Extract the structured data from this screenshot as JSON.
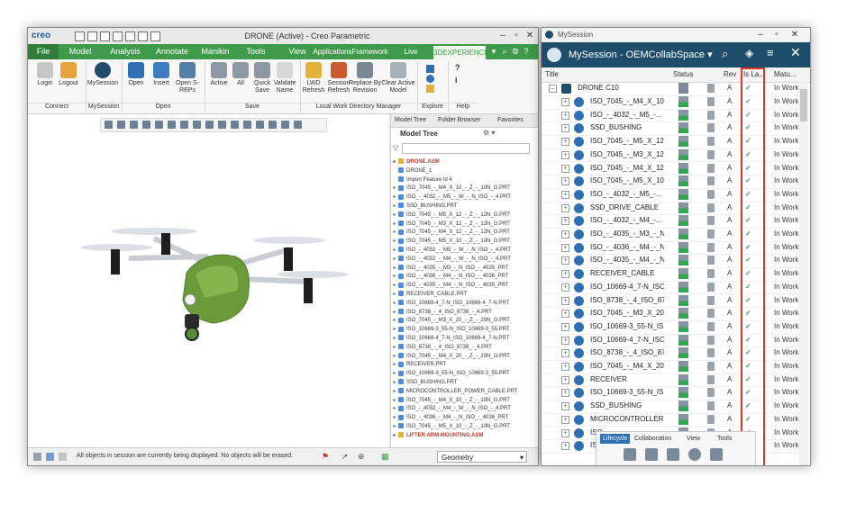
{
  "creo": {
    "logo": "creo",
    "window_title": "DRONE (Active) - Creo Parametric",
    "tabs": [
      "File",
      "Model",
      "Analysis",
      "Annotate",
      "Manikin",
      "Tools",
      "View",
      "ApplicationsFramework",
      "Live Simulation",
      "3DEXPERIENCE"
    ],
    "ribbon": {
      "buttons": [
        {
          "label": "Login"
        },
        {
          "label": "Logout"
        },
        {
          "label": "MySession"
        },
        {
          "label": "Open"
        },
        {
          "label": "Insert"
        },
        {
          "label": "Open S-REPs"
        },
        {
          "label": "Active"
        },
        {
          "label": "All"
        },
        {
          "label": "Quick Save"
        },
        {
          "label": "Validate Name"
        },
        {
          "label": "LWD Refresh"
        },
        {
          "label": "Session Refresh"
        },
        {
          "label": "Replace By Revision"
        },
        {
          "label": "Clear Active Model"
        }
      ],
      "groups": [
        "Connect",
        "MySession",
        "Open",
        "Save",
        "Local Work Directory Manager",
        "Explore",
        "Help"
      ]
    },
    "tree_tabs": [
      "Model Tree",
      "Folder Browser",
      "Favorites"
    ],
    "tree_header": "Model Tree",
    "tree_items": [
      {
        "t": "DRONE.ASM",
        "red": true
      },
      {
        "t": "DRONE_1"
      },
      {
        "t": "Import Feature id 4"
      },
      {
        "t": "ISO_7045_-_M4_X_10_-_Z_-_10N_G.PRT"
      },
      {
        "t": "ISO_-_4032_-_M5_-_W_-_N_ISO_-_4.PRT"
      },
      {
        "t": "SSD_BUSHING.PRT"
      },
      {
        "t": "ISO_7045_-_M5_X_12_-_Z_-_12N_G.PRT"
      },
      {
        "t": "ISO_7045_-_M3_X_12_-_Z_-_12N_G.PRT"
      },
      {
        "t": "ISO_7045_-_M4_X_12_-_Z_-_12N_G.PRT"
      },
      {
        "t": "ISO_7045_-_M5_X_10_-_Z_-_10N_G.PRT"
      },
      {
        "t": "ISO_-_4032_-_M5_-_W_-_N_ISO_-_4.PRT"
      },
      {
        "t": "ISO_-_4032_-_M4_-_W_-_N_ISO_-_4.PRT"
      },
      {
        "t": "ISO_-_4035_-_M3_-_N_ISO_-_4035_PRT"
      },
      {
        "t": "ISO_-_4036_-_M4_-_N_ISO_-_4036_PRT"
      },
      {
        "t": "ISO_-_4035_-_M4_-_N_ISO_-_4035_PRT"
      },
      {
        "t": "RECEIVER_CABLE.PRT"
      },
      {
        "t": "ISO_10669-4_7-N_ISO_10669-4_7-N.PRT"
      },
      {
        "t": "ISO_8738_-_4_ISO_8738_-_4.PRT"
      },
      {
        "t": "ISO_7045_-_M3_X_20_-_Z_-_20N_G.PRT"
      },
      {
        "t": "ISO_10669-3_55-N_ISO_10669-3_55.PRT"
      },
      {
        "t": "ISO_10669-4_7-N_ISO_10669-4_7-N.PRT"
      },
      {
        "t": "ISO_8738_-_4_ISO_8738_-_4.PRT"
      },
      {
        "t": "ISO_7045_-_M4_X_20_-_Z_-_20N_G.PRT"
      },
      {
        "t": "RECEIVER.PRT"
      },
      {
        "t": "ISO_10669-3_55-N_ISO_10669-3_55.PRT"
      },
      {
        "t": "SSD_BUSHING.PRT"
      },
      {
        "t": "MICROCONTROLLER_POWER_CABLE.PRT"
      },
      {
        "t": "ISO_7045_-_M4_X_10_-_Z_-_10N_G.PRT"
      },
      {
        "t": "ISO_-_4032_-_M4_-_W_-_N_ISO_-_4.PRT"
      },
      {
        "t": "ISO_-_4036_-_M4_-_N_ISO_-_4036_PRT"
      },
      {
        "t": "ISO_7045_-_M5_X_10_-_Z_-_10N_G.PRT"
      },
      {
        "t": "LIFTER ARM MOUNTING.ASM",
        "red": true
      }
    ],
    "status_message": "All objects in session are currently being displayed. No objects will be erased.",
    "geometry_select": "Geometry"
  },
  "mysession": {
    "window_title": "MySession",
    "header": "MySession - OEMCollabSpace",
    "columns": [
      "Title",
      "Status",
      "Rev",
      "Is La...",
      "Matu..."
    ],
    "root": "DRONE C10",
    "rows": [
      {
        "t": "ISO_7045_-_M4_X_10...",
        "rev": "A",
        "mat": "In Work"
      },
      {
        "t": "ISO_-_4032_-_M5_-...",
        "rev": "A",
        "mat": "In Work"
      },
      {
        "t": "SSD_BUSHING",
        "rev": "A",
        "mat": "In Work"
      },
      {
        "t": "ISO_7045_-_M5_X_12...",
        "rev": "A",
        "mat": "In Work"
      },
      {
        "t": "ISO_7045_-_M3_X_12...",
        "rev": "A",
        "mat": "In Work"
      },
      {
        "t": "ISO_7045_-_M4_X_12...",
        "rev": "A",
        "mat": "In Work"
      },
      {
        "t": "ISO_7045_-_M5_X_10...",
        "rev": "A",
        "mat": "In Work"
      },
      {
        "t": "ISO_-_4032_-_M5_-...",
        "rev": "A",
        "mat": "In Work"
      },
      {
        "t": "SSD_DRIVE_CABLE",
        "rev": "A",
        "mat": "In Work"
      },
      {
        "t": "ISO_-_4032_-_M4_-...",
        "rev": "A",
        "mat": "In Work"
      },
      {
        "t": "ISO_-_4035_-_M3_-_N...",
        "rev": "A",
        "mat": "In Work"
      },
      {
        "t": "ISO_-_4036_-_M4_-_N...",
        "rev": "A",
        "mat": "In Work"
      },
      {
        "t": "ISO_-_4035_-_M4_-_N...",
        "rev": "A",
        "mat": "In Work"
      },
      {
        "t": "RECEIVER_CABLE",
        "rev": "A",
        "mat": "In Work"
      },
      {
        "t": "ISO_10669-4_7-N_ISO...",
        "rev": "A",
        "mat": "In Work"
      },
      {
        "t": "ISO_8738_-_4_ISO_87...",
        "rev": "A",
        "mat": "In Work"
      },
      {
        "t": "ISO_7045_-_M3_X_20...",
        "rev": "A",
        "mat": "In Work"
      },
      {
        "t": "ISO_10669-3_55-N_IS...",
        "rev": "A",
        "mat": "In Work"
      },
      {
        "t": "ISO_10669-4_7-N_ISO...",
        "rev": "A",
        "mat": "In Work"
      },
      {
        "t": "ISO_8738_-_4_ISO_87...",
        "rev": "A",
        "mat": "In Work"
      },
      {
        "t": "ISO_7045_-_M4_X_20...",
        "rev": "A",
        "mat": "In Work"
      },
      {
        "t": "RECEIVER",
        "rev": "A",
        "mat": "In Work"
      },
      {
        "t": "ISO_10669-3_55-N_IS...",
        "rev": "A",
        "mat": "In Work"
      },
      {
        "t": "SSD_BUSHING",
        "rev": "A",
        "mat": "In Work"
      },
      {
        "t": "MICROCONTROLLER...",
        "rev": "A",
        "mat": "In Work"
      },
      {
        "t": "ISO...",
        "rev": "A",
        "mat": "In Work"
      },
      {
        "t": "ISO...",
        "rev": "A",
        "mat": "In Work"
      }
    ],
    "lifecycle_tabs": [
      "Lifecycle",
      "Collaboration",
      "View",
      "Tools"
    ],
    "colors": {
      "header": "#1e4d6b",
      "check": "#2fa84f",
      "highlight": "#d9342b",
      "ribbon": "#3f9b4b"
    }
  }
}
